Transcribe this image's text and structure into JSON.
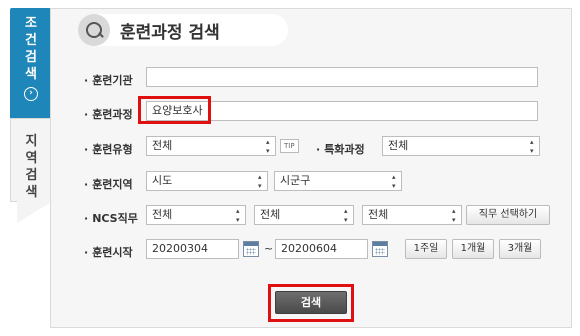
{
  "tabs": {
    "condition_search": {
      "chars": [
        "조",
        "건",
        "검",
        "색"
      ],
      "arrow": "›"
    },
    "region_search": {
      "chars": [
        "지",
        "역",
        "검",
        "색"
      ]
    }
  },
  "title": {
    "icon": "search-help-icon",
    "text": "훈련과정 검색"
  },
  "form": {
    "institution": {
      "label": "훈련기관",
      "value": ""
    },
    "course": {
      "label": "훈련과정",
      "value": "요양보호사"
    },
    "training_type": {
      "label": "훈련유형",
      "value": "전체",
      "tip": "TIP"
    },
    "special_course": {
      "label": "특화과정",
      "value": "전체"
    },
    "region": {
      "label": "훈련지역",
      "sido": "시도",
      "sigungu": "시군구"
    },
    "ncs": {
      "label": "NCS직무",
      "level1": "전체",
      "level2": "전체",
      "level3": "전체",
      "select_button": "직무 선택하기"
    },
    "start": {
      "label": "훈련시작",
      "from": "20200304",
      "separator": "~",
      "to": "20200604",
      "ranges": [
        "1주일",
        "1개월",
        "3개월"
      ]
    }
  },
  "search_button": "검색",
  "colors": {
    "active_tab": "#1e86b8",
    "highlight": "#e01010",
    "search_button": "#555555"
  }
}
